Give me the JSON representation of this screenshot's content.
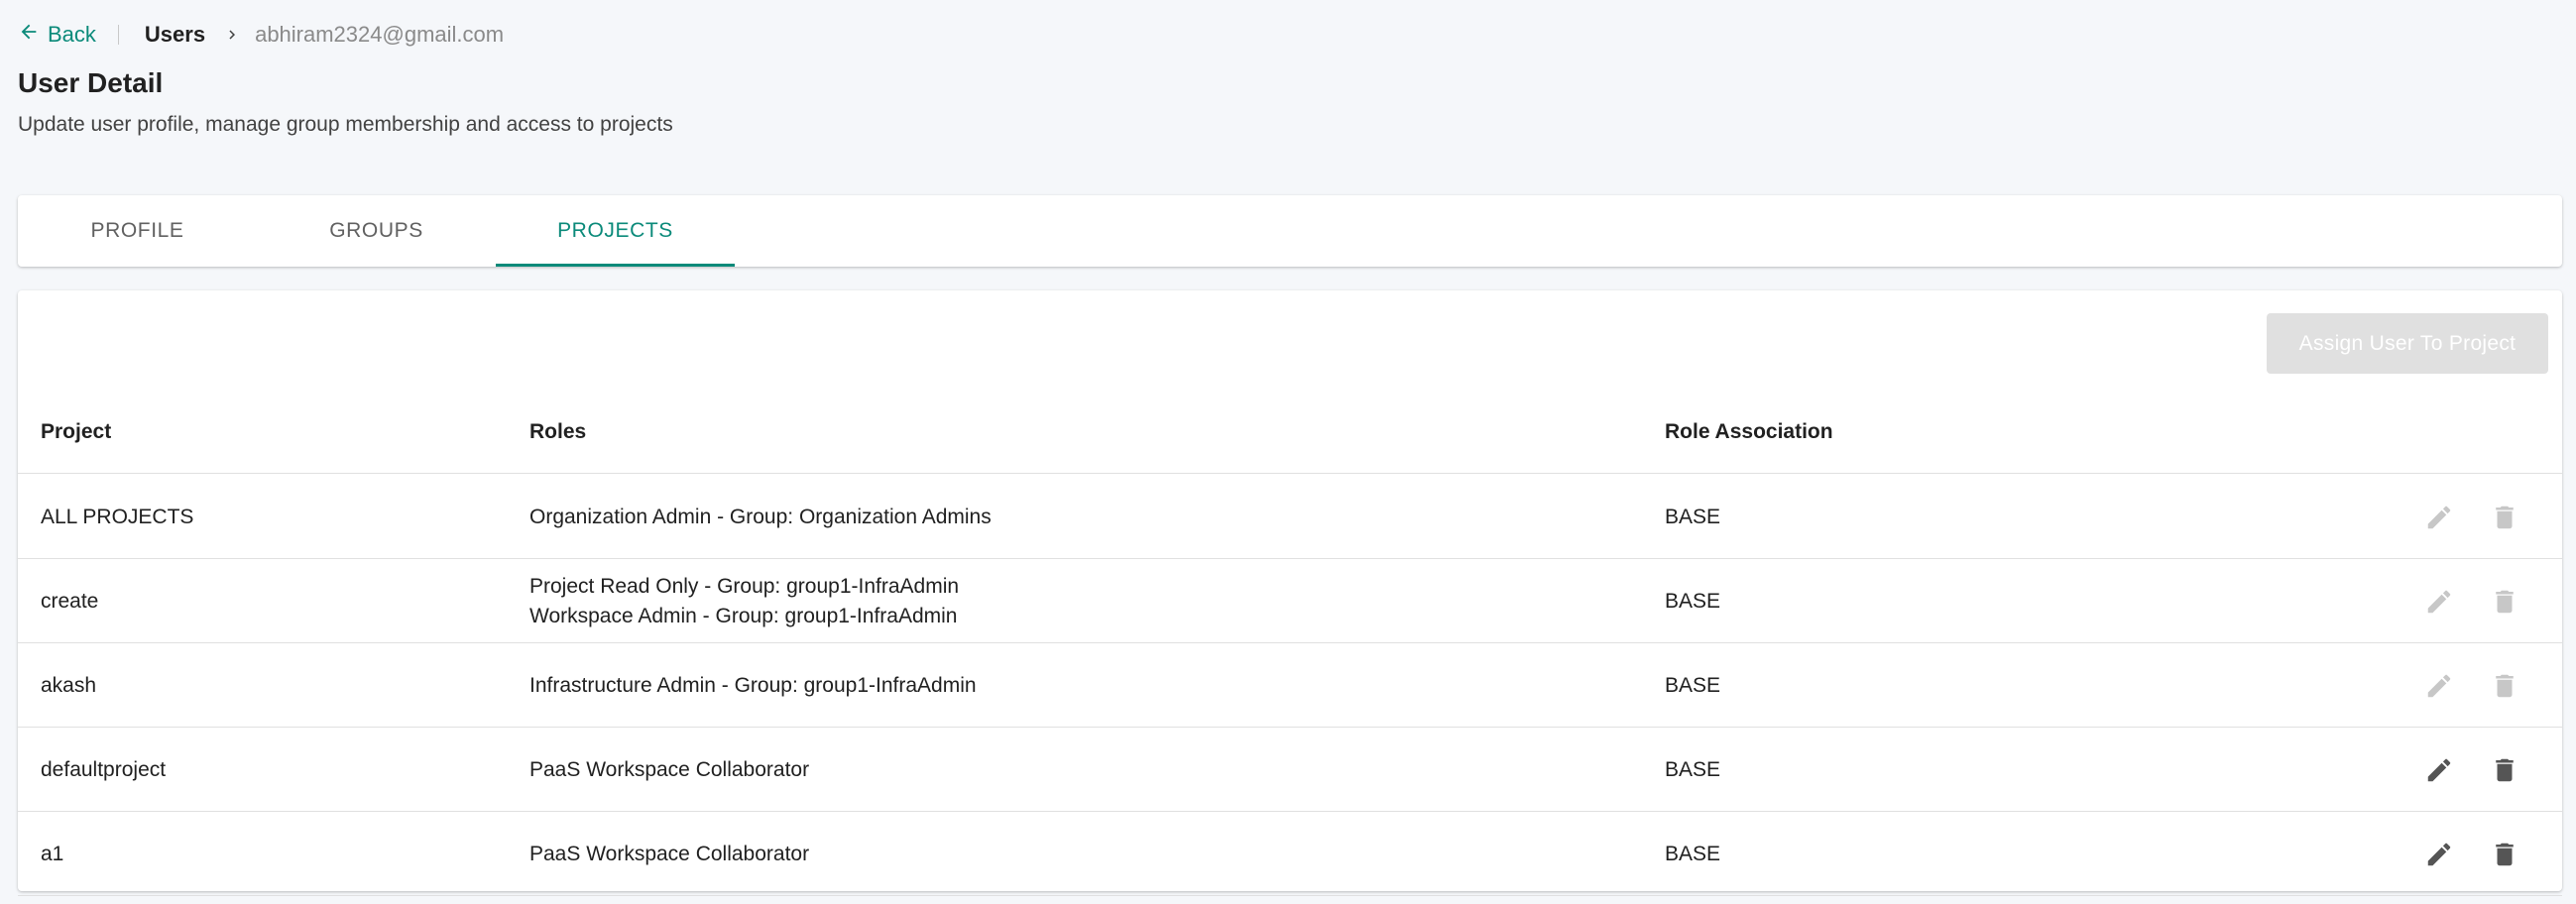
{
  "breadcrumb": {
    "back_label": "Back",
    "users_label": "Users",
    "email": "abhiram2324@gmail.com"
  },
  "header": {
    "title": "User Detail",
    "subtitle": "Update user profile, manage group membership and access to projects"
  },
  "tabs": [
    {
      "label": "PROFILE",
      "active": false
    },
    {
      "label": "GROUPS",
      "active": false
    },
    {
      "label": "PROJECTS",
      "active": true
    }
  ],
  "table": {
    "assign_button": "Assign User To Project",
    "columns": [
      "Project",
      "Roles",
      "Role Association"
    ],
    "rows": [
      {
        "project": "ALL PROJECTS",
        "roles": [
          "Organization Admin  - Group: Organization Admins"
        ],
        "association": "BASE",
        "actions_enabled": false
      },
      {
        "project": "create",
        "roles": [
          "Project Read Only  - Group: group1-InfraAdmin",
          "Workspace Admin  - Group: group1-InfraAdmin"
        ],
        "association": "BASE",
        "actions_enabled": false
      },
      {
        "project": "akash",
        "roles": [
          "Infrastructure Admin  - Group: group1-InfraAdmin"
        ],
        "association": "BASE",
        "actions_enabled": false
      },
      {
        "project": "defaultproject",
        "roles": [
          "PaaS Workspace Collaborator"
        ],
        "association": "BASE",
        "actions_enabled": true
      },
      {
        "project": "a1",
        "roles": [
          "PaaS Workspace Collaborator"
        ],
        "association": "BASE",
        "actions_enabled": true
      }
    ]
  },
  "colors": {
    "accent": "#0b8a7a",
    "disabled_icon": "#c7c7c7",
    "enabled_icon": "#555555",
    "disabled_button_bg": "#e0e0e0"
  },
  "icons": {
    "back": "arrow-left-icon",
    "separator": "chevron-right-icon",
    "edit": "pencil-icon",
    "delete": "trash-icon"
  }
}
